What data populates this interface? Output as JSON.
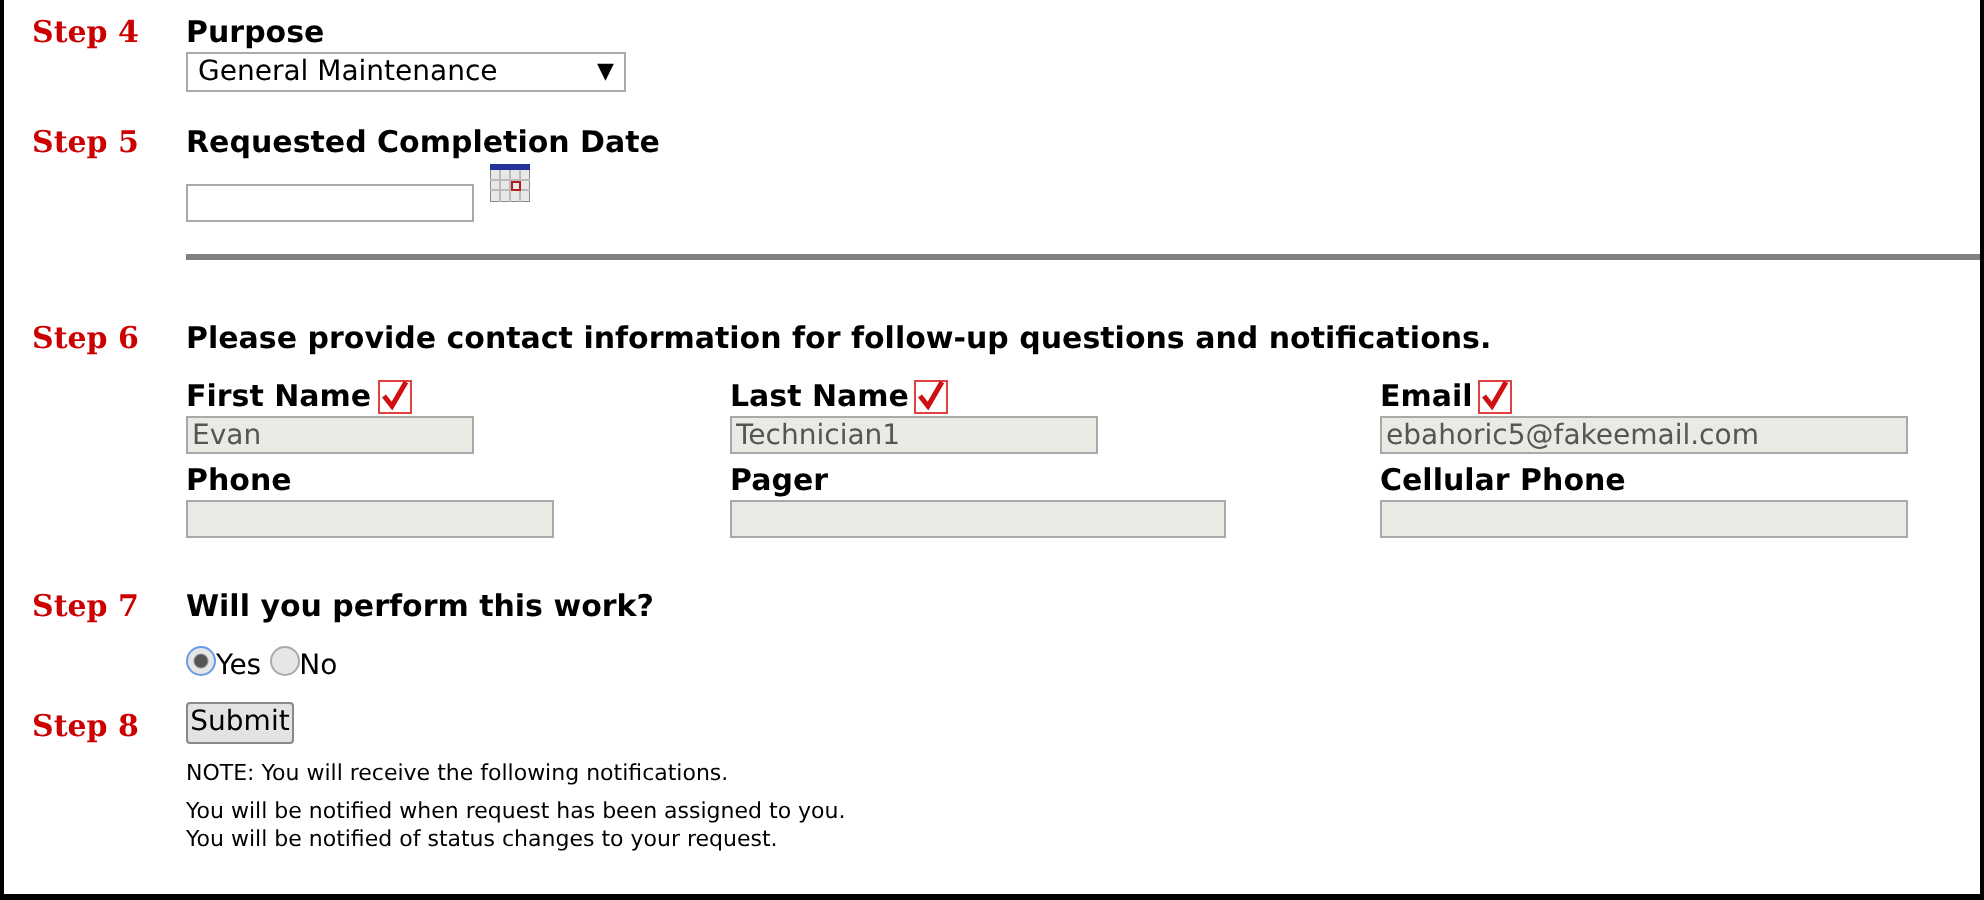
{
  "steps": [
    {
      "label": "Step 4",
      "kind": "select",
      "title": "Purpose",
      "value": "General Maintenance",
      "arrow": "▼"
    },
    {
      "label": "Step 5",
      "kind": "date",
      "title": "Requested Completion Date"
    },
    {
      "label": "Step 6",
      "kind": "contact",
      "title": "Please provide contact information for follow-up questions and notifications.",
      "fields": [
        {
          "label": "First Name",
          "required": true,
          "value": "Evan",
          "disabled": true
        },
        {
          "label": "Last Name",
          "required": true,
          "value": "Technician1",
          "disabled": true
        },
        {
          "label": "Email",
          "required": true,
          "value": "ebahoric5@fakeemail.com",
          "disabled": true
        },
        {
          "label": "Phone",
          "required": false,
          "disabled": true
        },
        {
          "label": "Pager",
          "required": false,
          "disabled": true
        },
        {
          "label": "Cellular Phone",
          "required": false,
          "disabled": true
        }
      ]
    },
    {
      "label": "Step 7",
      "kind": "radio",
      "title": "Will you perform this work?",
      "options": [
        {
          "label": "Yes",
          "selected": true
        },
        {
          "label": "No",
          "selected": false
        }
      ]
    },
    {
      "label": "Step 8",
      "kind": "submit",
      "button": "Submit",
      "notes": [
        "NOTE: You will receive the following notifications.",
        "You will be notified when request has been assigned to you.",
        "You will be notified of status changes to your request."
      ]
    }
  ]
}
